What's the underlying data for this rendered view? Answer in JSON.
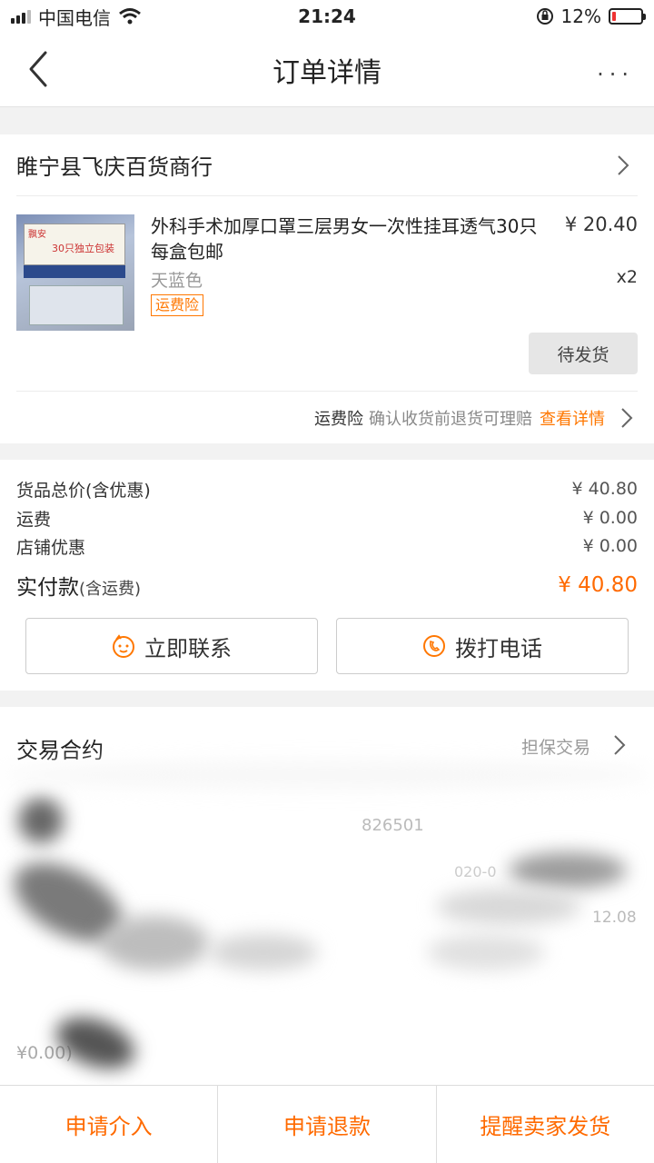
{
  "status_bar": {
    "carrier": "中国电信",
    "time": "21:24",
    "battery": "12%",
    "battery_level": 0.12
  },
  "nav": {
    "title": "订单详情",
    "more": "···"
  },
  "shop": {
    "name": "睢宁县飞庆百货商行"
  },
  "product": {
    "title": "外科手术加厚口罩三层男女一次性挂耳透气30只每盒包邮",
    "price": "¥ 20.40",
    "sku": "天蓝色",
    "qty": "x2",
    "badge": "运费险",
    "image_brand": "飘安",
    "image_text": "30只独立包装",
    "status": "待发货"
  },
  "insurance": {
    "label": "运费险",
    "desc": "确认收货前退货可理赔",
    "link": "查看详情"
  },
  "prices": {
    "goods_label": "货品总价(含优惠)",
    "goods_value": "¥ 40.80",
    "shipping_label": "运费",
    "shipping_value": "¥ 0.00",
    "discount_label": "店铺优惠",
    "discount_value": "¥ 0.00",
    "paid_label": "实付款",
    "paid_note": "(含运费)",
    "paid_value": "¥ 40.80"
  },
  "actions": {
    "contact": "立即联系",
    "call": "拨打电话"
  },
  "contract": {
    "title": "交易合约",
    "type": "担保交易",
    "order_no_partial": "826501",
    "date_partial": "020-0",
    "time_partial": "12.08",
    "extra_partial": "¥0.00)"
  },
  "bottom": {
    "intervene": "申请介入",
    "refund": "申请退款",
    "remind": "提醒卖家发货"
  },
  "colors": {
    "accent": "#ff6a00",
    "badge": "#ff7700"
  }
}
